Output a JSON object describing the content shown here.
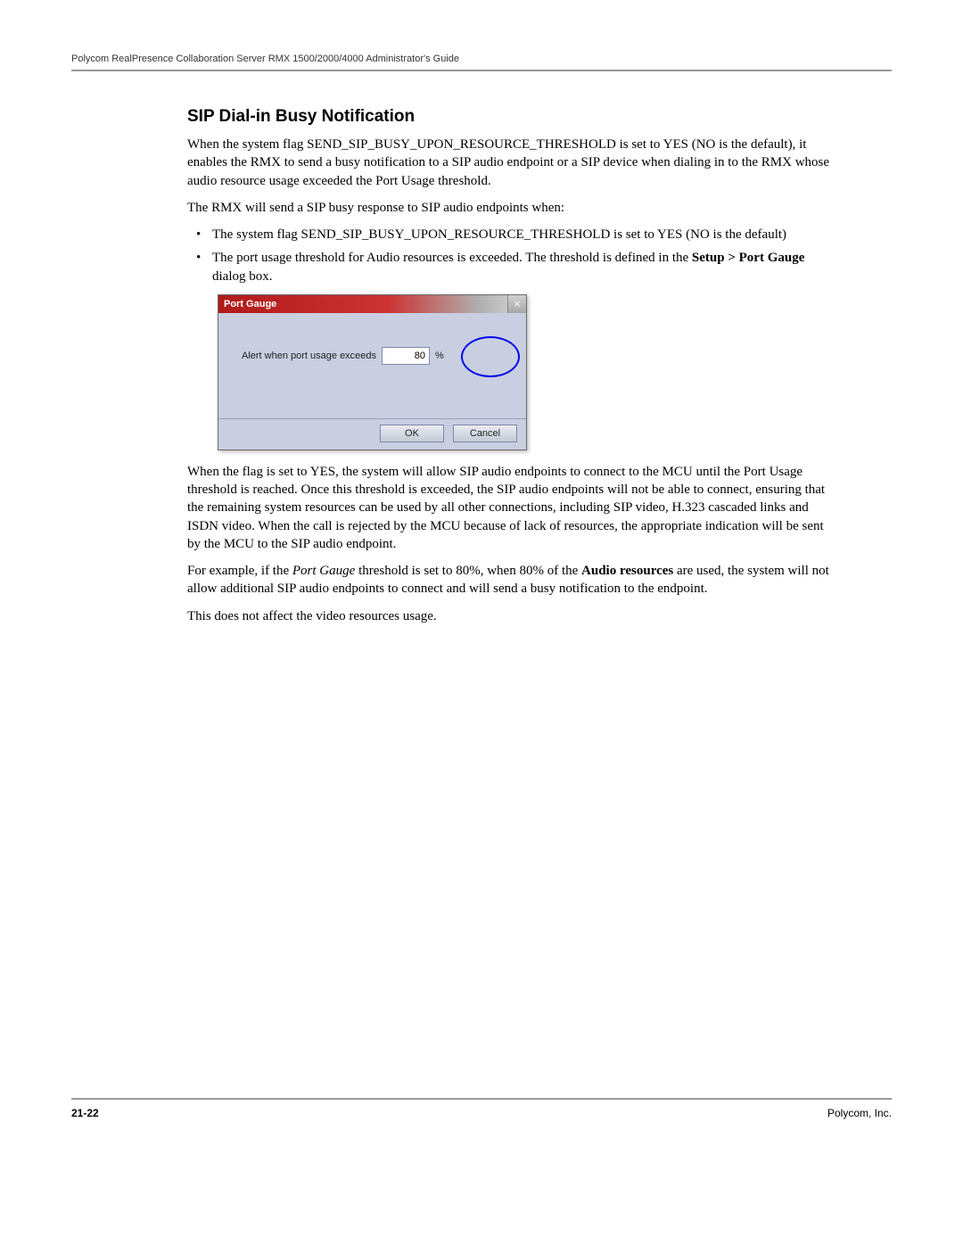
{
  "header": {
    "running_title": "Polycom RealPresence Collaboration Server RMX 1500/2000/4000 Administrator's Guide"
  },
  "section": {
    "title": "SIP Dial-in Busy Notification",
    "para1": "When the system flag SEND_SIP_BUSY_UPON_RESOURCE_THRESHOLD is set to YES (NO is the default), it enables the RMX to send a busy notification to a SIP audio endpoint or a SIP device when dialing in to the RMX whose audio resource usage exceeded the Port Usage threshold.",
    "para2": "The RMX will send a SIP busy response to SIP audio endpoints when:",
    "bullets": {
      "b1": "The system flag SEND_SIP_BUSY_UPON_RESOURCE_THRESHOLD is set to YES (NO is the default)",
      "b2_prefix": " The port usage threshold for Audio resources is exceeded. The threshold is defined in the ",
      "b2_bold": "Setup > Port Gauge",
      "b2_suffix": " dialog box."
    },
    "para3": "When the flag is set to YES, the system will allow SIP audio endpoints to connect to the MCU until the Port Usage threshold is reached. Once this threshold is exceeded, the SIP audio endpoints will not be able to connect, ensuring that the remaining system resources can be used by all other connections, including SIP video, H.323 cascaded links and ISDN video. When the call is rejected by the MCU because of lack of resources, the appropriate indication will be sent by the MCU to the SIP audio endpoint.",
    "para4_prefix": "For example, if the ",
    "para4_italic": "Port Gauge",
    "para4_mid": " threshold is set to 80%, when 80% of the ",
    "para4_bold": "Audio resources",
    "para4_suffix": " are used, the system will not allow additional SIP audio endpoints to connect and will send a busy notification to the endpoint.",
    "para5": "This does not affect the video resources usage."
  },
  "dialog": {
    "title": "Port Gauge",
    "field_label": "Alert when port usage exceeds",
    "value": "80",
    "percent": "%",
    "ok": "OK",
    "cancel": "Cancel"
  },
  "footer": {
    "page": "21-22",
    "company": "Polycom, Inc."
  }
}
